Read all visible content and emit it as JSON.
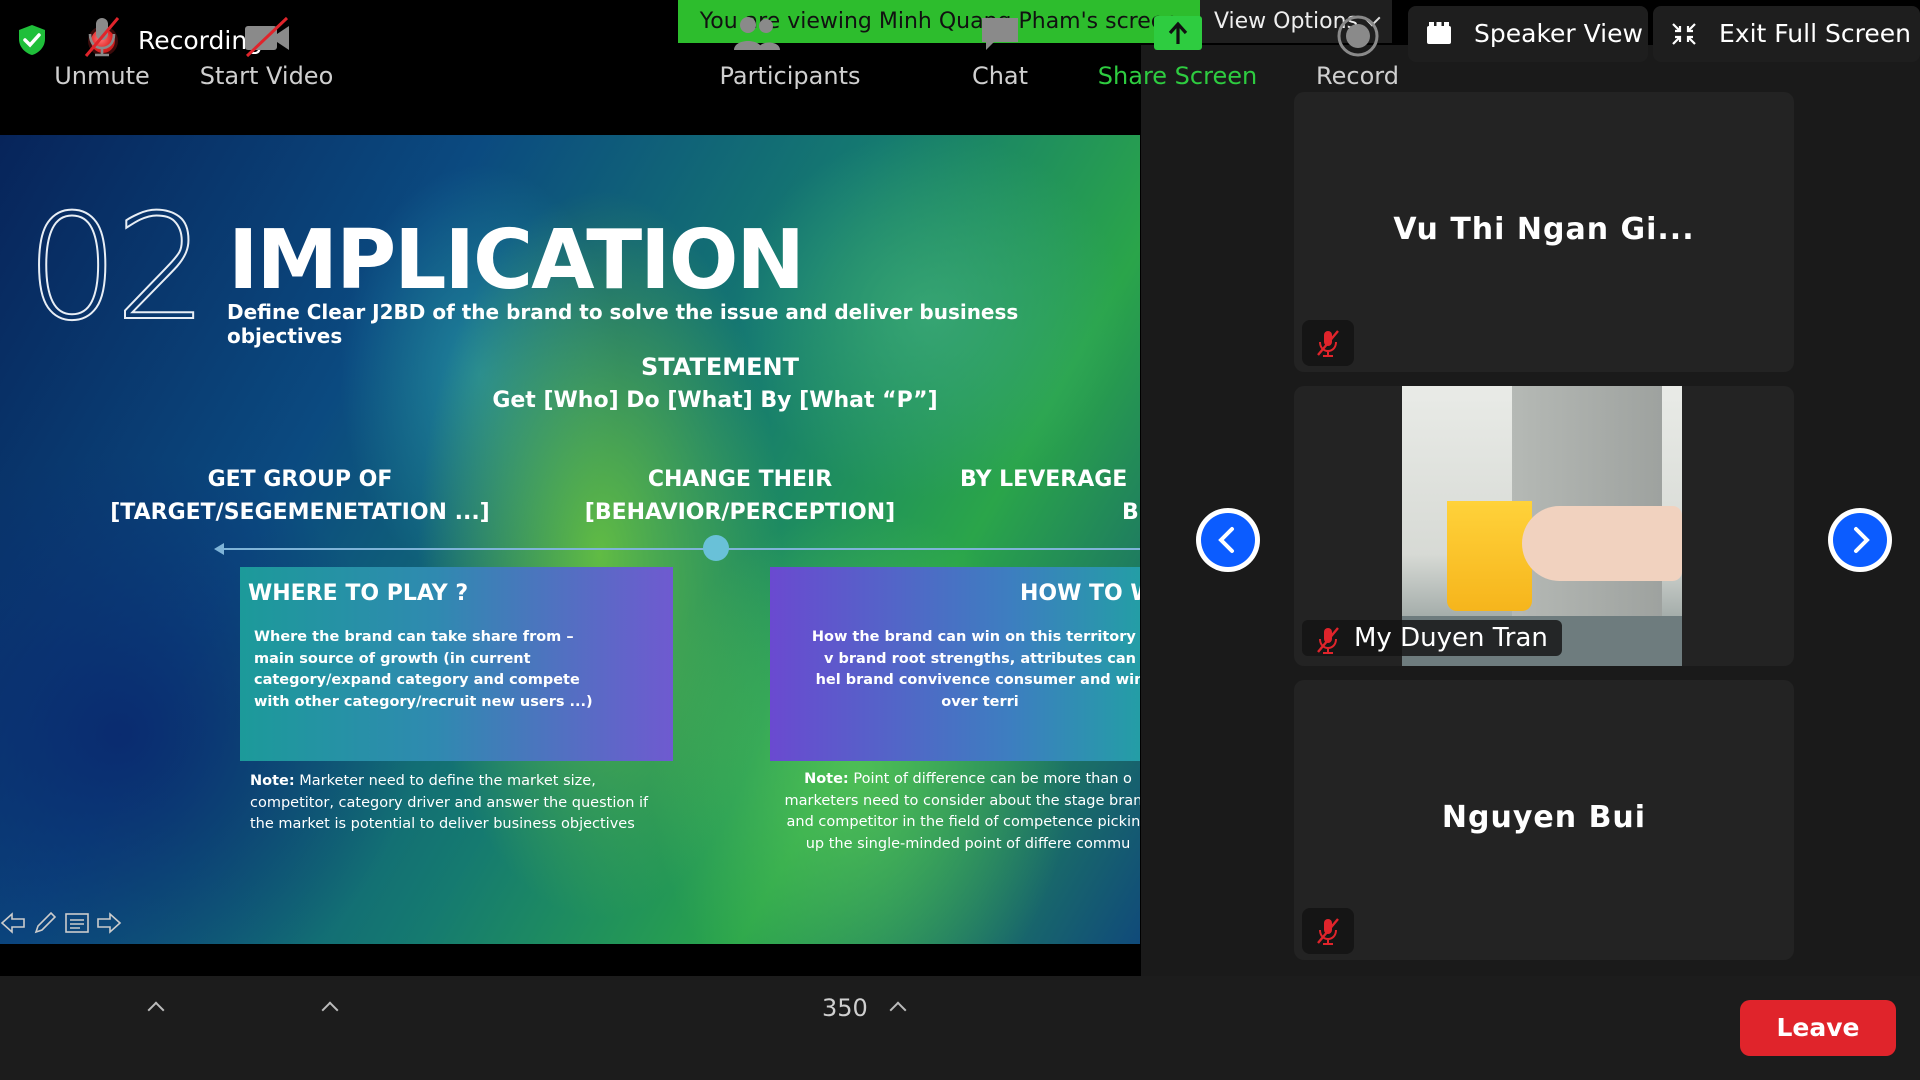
{
  "topbar": {
    "recording_label": "Recording",
    "viewing_banner": "You are viewing Minh Quang Pham's screen",
    "view_options_label": "View Options",
    "speaker_view_label": "Speaker View",
    "exit_fullscreen_label": "Exit Full Screen"
  },
  "slide": {
    "number": "02",
    "title": "IMPLICATION",
    "subtitle": "Define Clear J2BD of the brand to solve the issue and deliver business objectives",
    "statement_heading": "STATEMENT",
    "statement_formula": "Get [Who] Do [What] By [What “P”]",
    "columns": [
      {
        "line1": "GET GROUP OF",
        "line2": "[TARGET/SEGEMENETATION ...]"
      },
      {
        "line1": "CHANGE THEIR",
        "line2": "[BEHAVIOR/PERCEPTION]"
      },
      {
        "line1": "BY LEVERAGE",
        "line2": "B"
      }
    ],
    "box_where": {
      "heading": "WHERE TO PLAY ?",
      "body": "Where the brand can take share from – main source of growth (in current category/expand category and compete with other category/recruit new users ...)"
    },
    "box_how": {
      "heading": "HOW TO W",
      "body": "How the brand can win on this territory – v brand root strengths, attributes can hel brand convivence consumer and win over terri"
    },
    "note_left": {
      "label": "Note:",
      "text": " Marketer need to define the market size, competitor, category driver and answer the question if the market is potential to deliver business objectives"
    },
    "note_right": {
      "label": "Note:",
      "text": " Point of difference can be more than o marketers need to consider about the stage brand and competitor in the field of competence picking up the single-minded point of differe commu"
    }
  },
  "participants_panel": {
    "tiles": [
      {
        "name": "Vu Thi Ngan Gi...",
        "muted": true,
        "video": false
      },
      {
        "name": "My Duyen Tran",
        "muted": true,
        "video": true
      },
      {
        "name": "Nguyen Bui",
        "muted": true,
        "video": false
      }
    ]
  },
  "toolbar": {
    "unmute_label": "Unmute",
    "start_video_label": "Start Video",
    "participants_label": "Participants",
    "participants_count": "350",
    "chat_label": "Chat",
    "share_screen_label": "Share Screen",
    "record_label": "Record",
    "leave_label": "Leave"
  },
  "colors": {
    "share_green": "#2ecc40",
    "banner_green": "#2dbd2d",
    "leave_red": "#e0242b",
    "nav_blue": "#0b5cff"
  }
}
